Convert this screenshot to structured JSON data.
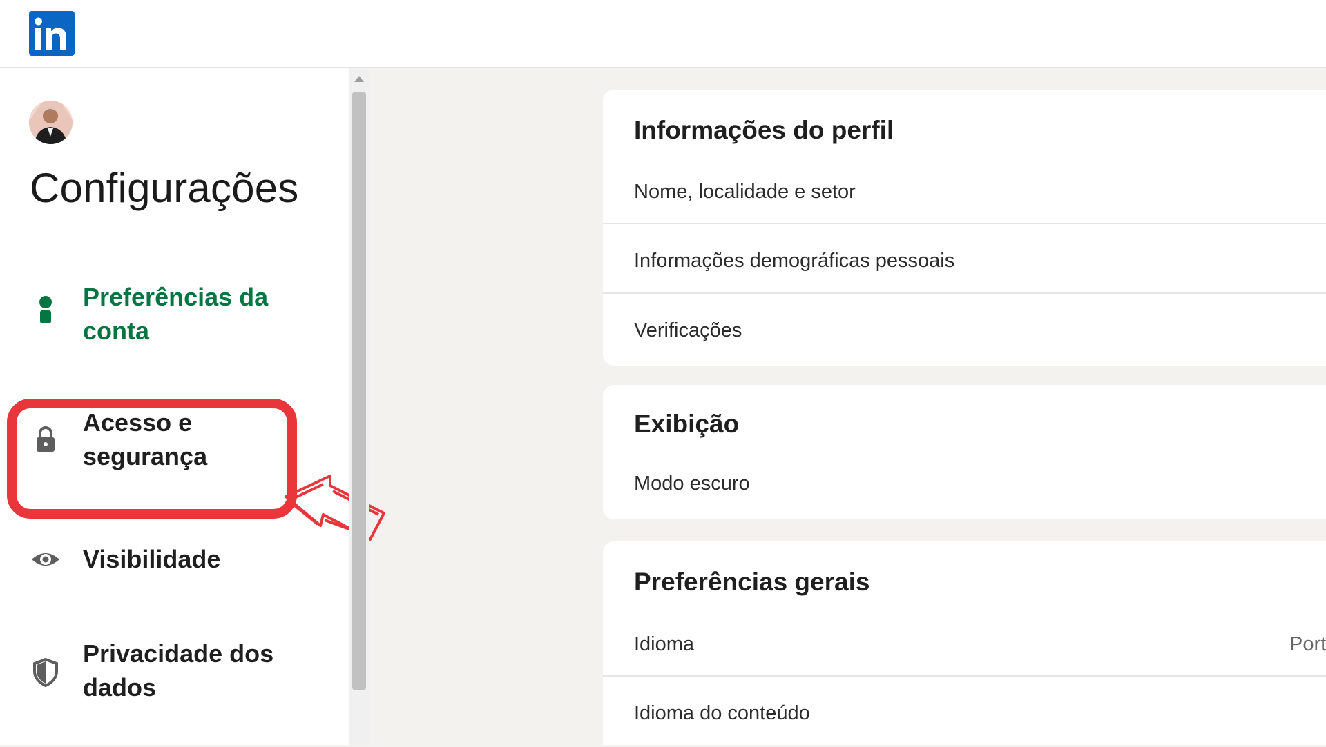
{
  "brand": {
    "logo_text": "in",
    "color": "#0a66c2"
  },
  "sidebar": {
    "title": "Configurações",
    "items": [
      {
        "label": "Preferências da conta",
        "icon": "person-icon",
        "active": true
      },
      {
        "label": "Acesso e segurança",
        "icon": "lock-icon",
        "active": false
      },
      {
        "label": "Visibilidade",
        "icon": "eye-icon",
        "active": false
      },
      {
        "label": "Privacidade dos dados",
        "icon": "shield-icon",
        "active": false
      }
    ]
  },
  "annotation": {
    "highlight_color": "#e8363b",
    "highlighted_item": "Acesso e segurança"
  },
  "sections": [
    {
      "title": "Informações do perfil",
      "rows": [
        {
          "label": "Nome, localidade e setor"
        },
        {
          "label": "Informações demográficas pessoais"
        },
        {
          "label": "Verificações"
        }
      ]
    },
    {
      "title": "Exibição",
      "rows": [
        {
          "label": "Modo escuro"
        }
      ]
    },
    {
      "title": "Preferências gerais",
      "rows": [
        {
          "label": "Idioma",
          "value": "Port"
        },
        {
          "label": "Idioma do conteúdo"
        }
      ]
    }
  ],
  "colors": {
    "active_green": "#057642",
    "page_background": "#f4f2ee"
  }
}
